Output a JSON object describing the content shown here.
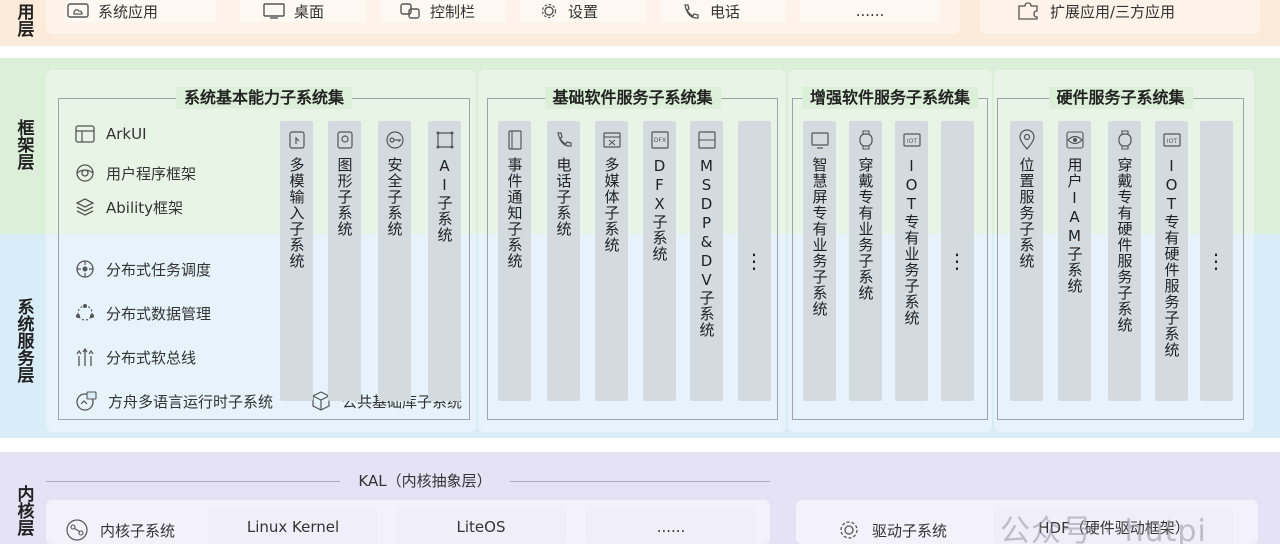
{
  "colors": {
    "app": "#fcebd8",
    "framework": "#dcefd8",
    "service": "#d9edf9",
    "kernel": "#e5e2f6",
    "column": "#d4dbe0"
  },
  "layers": {
    "app": "用层",
    "framework": "框架层",
    "service": "系统服务层",
    "kernel": "内核层"
  },
  "app_layer": {
    "items": [
      {
        "icon": "monitor-cloud-icon",
        "label": "系统应用"
      },
      {
        "icon": "monitor-icon",
        "label": "桌面"
      },
      {
        "icon": "control-bar-icon",
        "label": "控制栏"
      },
      {
        "icon": "gear-icon",
        "label": "设置"
      },
      {
        "icon": "phone-icon",
        "label": "电话"
      },
      {
        "icon": "",
        "label": "......"
      }
    ],
    "extension": {
      "icon": "puzzle-icon",
      "label": "扩展应用/三方应用"
    }
  },
  "groups": [
    {
      "title": "系统基本能力子系统集",
      "capabilities": [
        {
          "icon": "arkui-icon",
          "label": "ArkUI"
        },
        {
          "icon": "program-framework-icon",
          "label": "用户程序框架"
        },
        {
          "icon": "layers-icon",
          "label": "Ability框架"
        },
        {
          "icon": "task-schedule-icon",
          "label": "分布式任务调度"
        },
        {
          "icon": "data-manage-icon",
          "label": "分布式数据管理"
        },
        {
          "icon": "soft-bus-icon",
          "label": "分布式软总线"
        },
        {
          "icon": "runtime-icon",
          "label": "方舟多语言运行时子系统"
        },
        {
          "icon": "cube-icon",
          "label": "公共基础库子系统"
        }
      ],
      "columns": [
        {
          "icon": "touch-icon",
          "label": "多模输入子系统"
        },
        {
          "icon": "image-icon",
          "label": "图形子系统"
        },
        {
          "icon": "key-icon",
          "label": "安全子系统"
        },
        {
          "icon": "ai-icon",
          "label": "AI子系统"
        }
      ]
    },
    {
      "title": "基础软件服务子系统集",
      "columns": [
        {
          "icon": "notification-icon",
          "label": "事件通知子系统"
        },
        {
          "icon": "phone-icon",
          "label": "电话子系统"
        },
        {
          "icon": "media-icon",
          "label": "多媒体子系统"
        },
        {
          "icon": "dfx-icon",
          "label": "DFX子系统"
        },
        {
          "icon": "msdp-icon",
          "label": "MSDP&DV子系统"
        },
        {
          "icon": "",
          "label": "⋮"
        }
      ]
    },
    {
      "title": "增强软件服务子系统集",
      "columns": [
        {
          "icon": "smart-screen-icon",
          "label": "智慧屏专有业务子系统"
        },
        {
          "icon": "watch-icon",
          "label": "穿戴专有业务子系统"
        },
        {
          "icon": "iot-icon",
          "label": "IOT专有业务子系统"
        },
        {
          "icon": "",
          "label": "⋮"
        }
      ]
    },
    {
      "title": "硬件服务子系统集",
      "columns": [
        {
          "icon": "location-icon",
          "label": "位置服务子系统"
        },
        {
          "icon": "eye-icon",
          "label": "用户IAM子系统"
        },
        {
          "icon": "watch-icon",
          "label": "穿戴专有硬件服务子系统"
        },
        {
          "icon": "iot-icon",
          "label": "IOT专有硬件服务子系统"
        },
        {
          "icon": "",
          "label": "⋮"
        }
      ]
    }
  ],
  "kernel_layer": {
    "kal": "KAL（内核抽象层）",
    "subsystem": {
      "icon": "kernel-icon",
      "label": "内核子系统"
    },
    "kernels": [
      "Linux Kernel",
      "LiteOS",
      "......"
    ],
    "driver": {
      "icon": "driver-gear-icon",
      "label": "驱动子系统"
    },
    "hdf": "HDF（硬件驱动框架）"
  },
  "watermark": "公众号 · hutpi"
}
